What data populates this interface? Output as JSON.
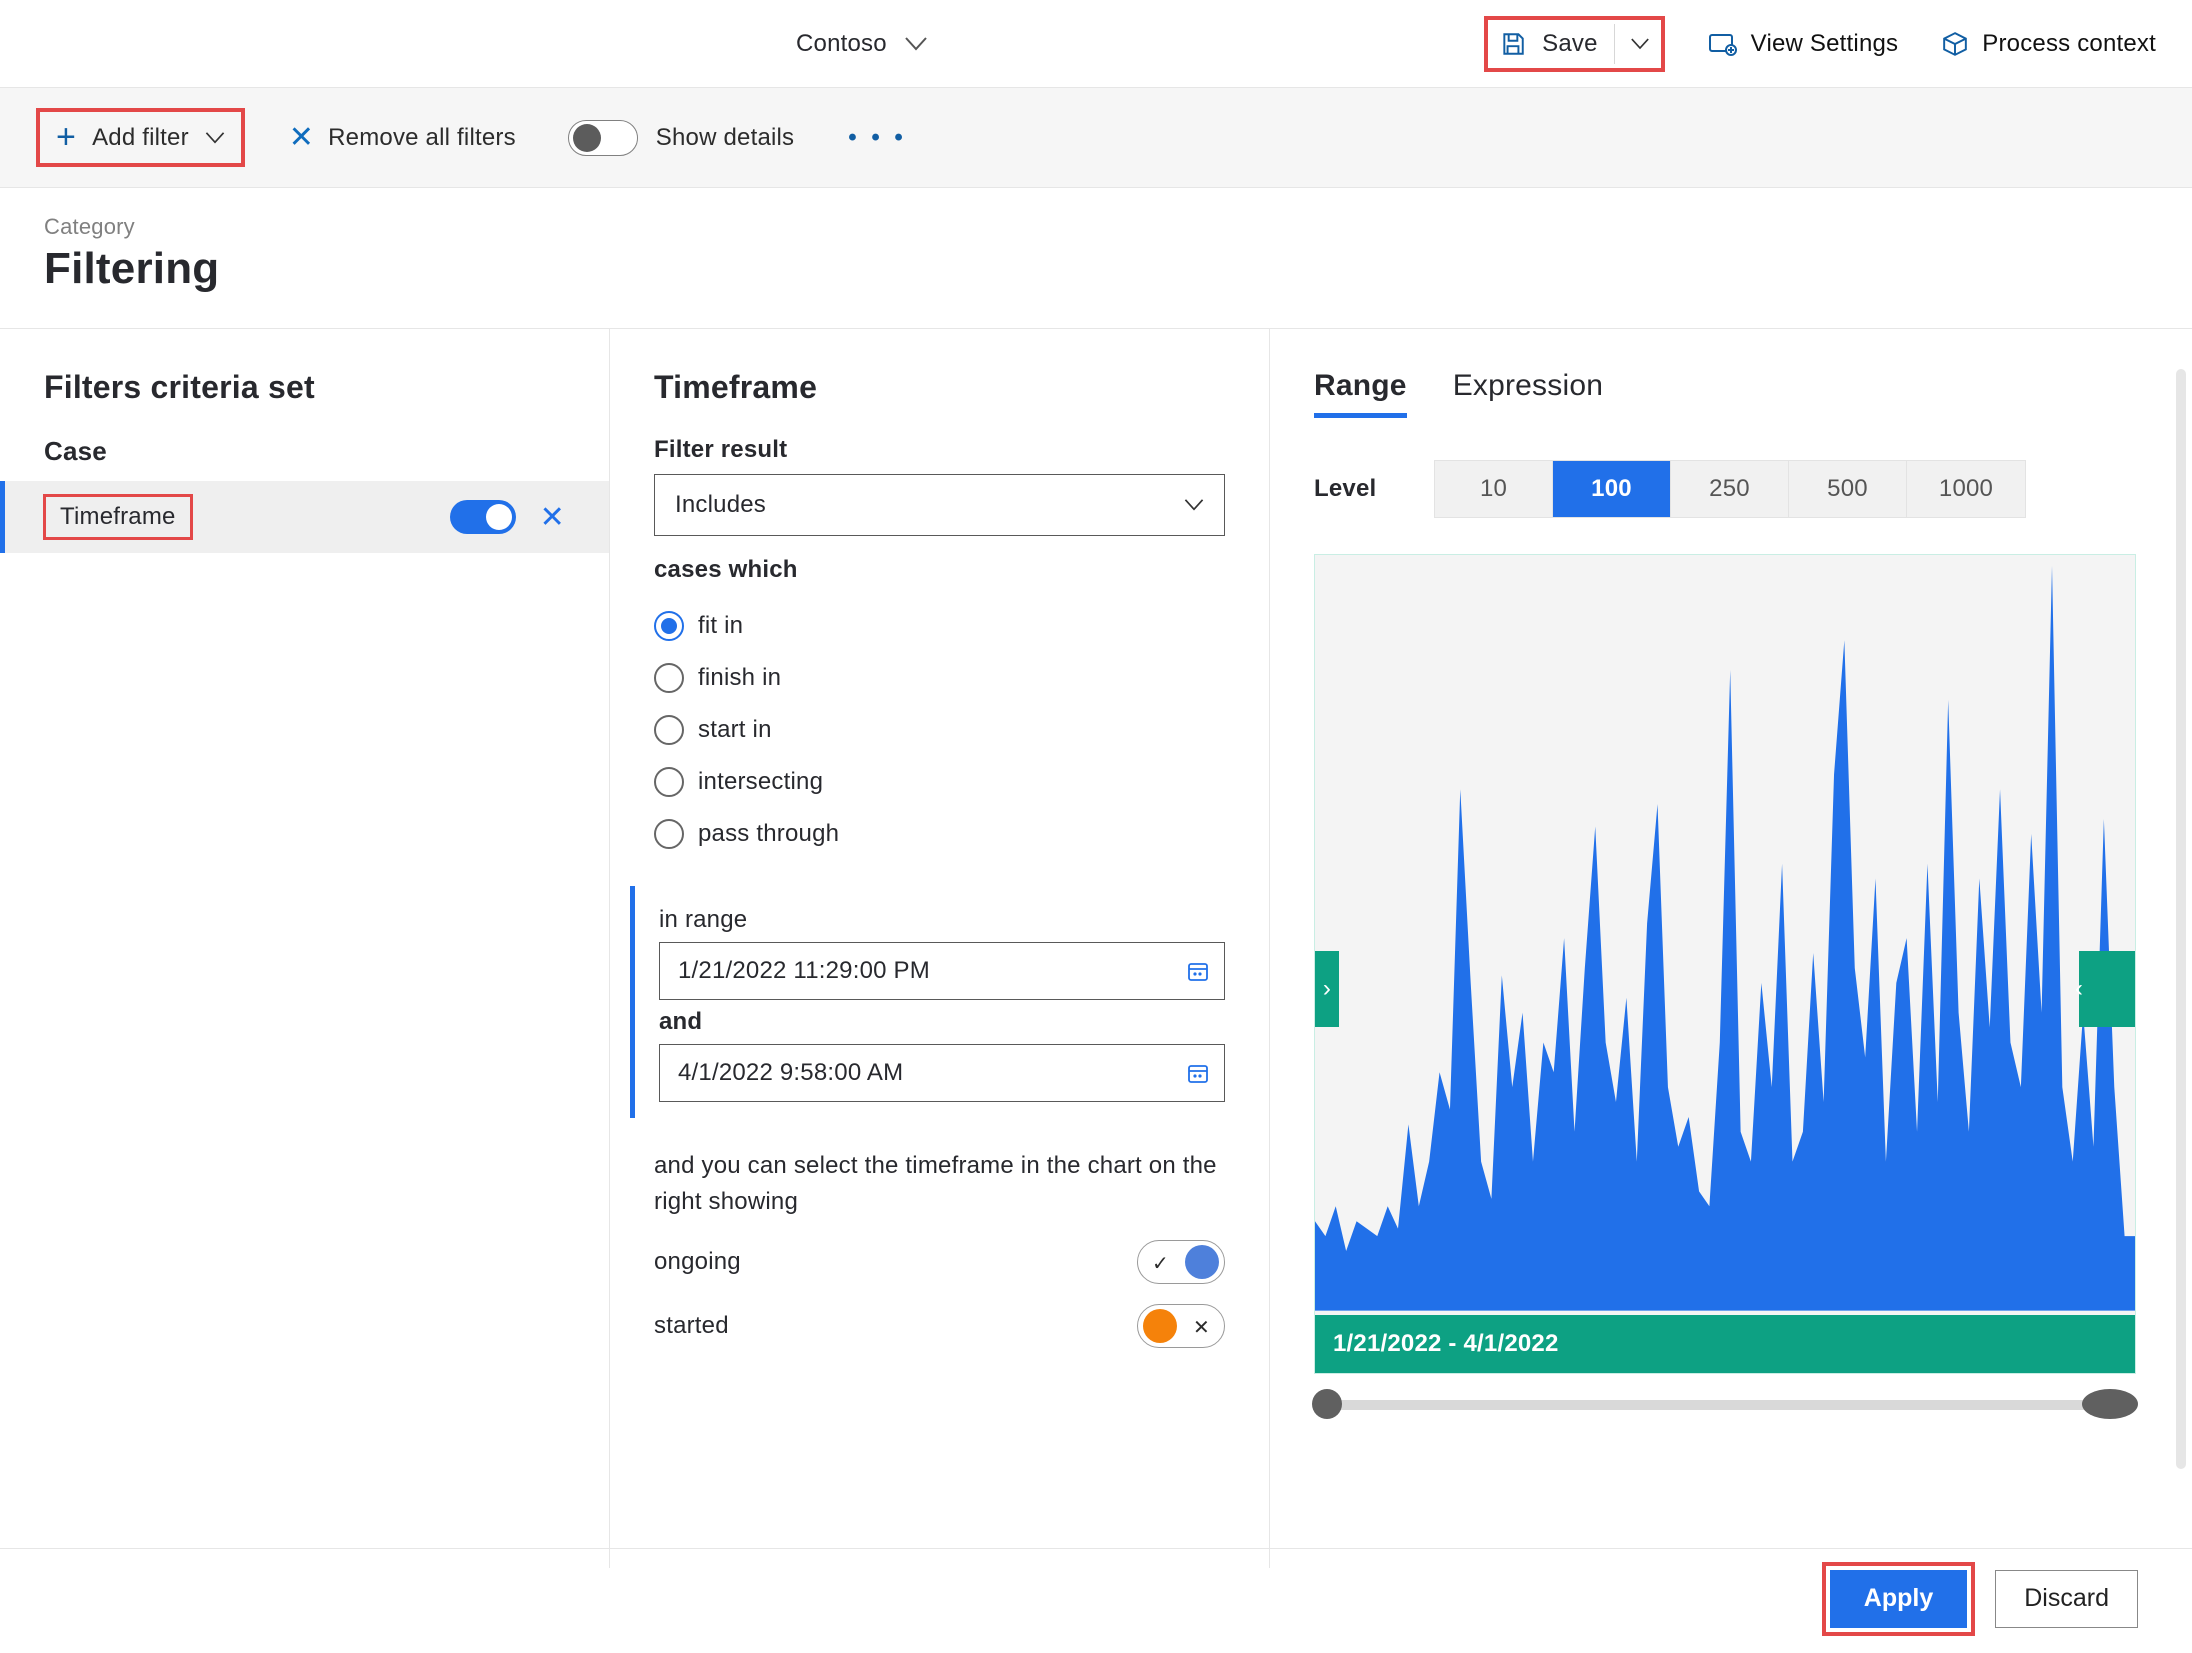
{
  "header": {
    "company": "Contoso",
    "save": "Save",
    "view_settings": "View Settings",
    "process_context": "Process context"
  },
  "filterbar": {
    "add_filter": "Add filter",
    "remove_all": "Remove all filters",
    "show_details": "Show details"
  },
  "page": {
    "crumb": "Category",
    "title": "Filtering"
  },
  "left": {
    "heading": "Filters criteria set",
    "group": "Case",
    "filters": [
      {
        "label": "Timeframe",
        "enabled": true
      }
    ]
  },
  "mid": {
    "heading": "Timeframe",
    "filter_result_label": "Filter result",
    "filter_result_value": "Includes",
    "cases_label": "cases which",
    "radios": {
      "fit_in": "fit in",
      "finish_in": "finish in",
      "start_in": "start in",
      "intersecting": "intersecting",
      "pass_through": "pass through"
    },
    "in_range_label": "in range",
    "date_from": "1/21/2022 11:29:00 PM",
    "and_label": "and",
    "date_to": "4/1/2022 9:58:00 AM",
    "help_text": "and you can select the timeframe in the chart on the right showing",
    "rows": {
      "ongoing": "ongoing",
      "started": "started"
    }
  },
  "right": {
    "tabs": {
      "range": "Range",
      "expression": "Expression"
    },
    "level_label": "Level",
    "levels": [
      "10",
      "100",
      "250",
      "500",
      "1000"
    ],
    "selected_level": "100",
    "chart_footer": "1/21/2022 - 4/1/2022"
  },
  "footer": {
    "apply": "Apply",
    "discard": "Discard"
  },
  "chart_data": {
    "type": "area",
    "title": "",
    "xlabel": "",
    "ylabel": "",
    "x_range_label": "1/21/2022 - 4/1/2022",
    "ylim": [
      0,
      100
    ],
    "values": [
      12,
      10,
      14,
      8,
      12,
      11,
      10,
      14,
      11,
      25,
      14,
      20,
      32,
      27,
      70,
      44,
      20,
      15,
      45,
      30,
      40,
      20,
      36,
      32,
      50,
      24,
      46,
      65,
      36,
      28,
      42,
      20,
      52,
      68,
      30,
      22,
      26,
      16,
      14,
      36,
      86,
      24,
      20,
      44,
      30,
      60,
      20,
      24,
      48,
      28,
      72,
      90,
      46,
      34,
      58,
      20,
      44,
      50,
      24,
      60,
      28,
      82,
      40,
      24,
      58,
      38,
      70,
      36,
      30,
      64,
      40,
      100,
      30,
      20,
      40,
      22,
      66,
      30,
      10,
      10
    ]
  }
}
